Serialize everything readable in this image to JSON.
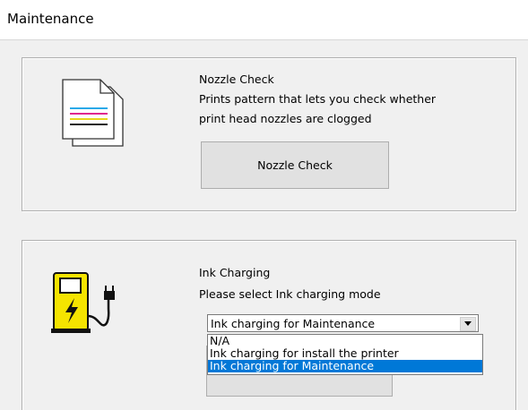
{
  "header": {
    "title": "Maintenance"
  },
  "nozzle": {
    "title": "Nozzle Check",
    "desc_line1": "Prints pattern that lets you check whether",
    "desc_line2": "print head nozzles are clogged",
    "button_label": "Nozzle Check"
  },
  "ink": {
    "title": "Ink Charging",
    "desc": "Please select Ink charging mode",
    "selected": "Ink charging for Maintenance",
    "options": [
      "N/A",
      "Ink charging for install the printer",
      "Ink charging for Maintenance"
    ],
    "highlighted_option": 2
  },
  "icons": {
    "document": "document-pages-icon",
    "charger": "ink-charging-station-icon"
  },
  "colors": {
    "highlight": "#0078d7",
    "charger_yellow": "#f5e400"
  }
}
